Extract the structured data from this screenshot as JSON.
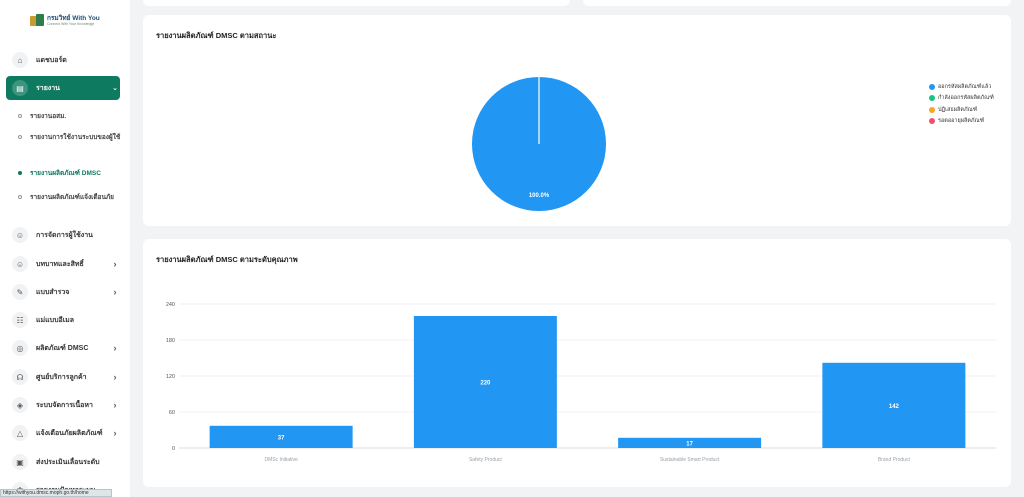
{
  "logo": {
    "title": "กรมวิทย์ With You",
    "subtitle": "Connect With Your Knowledge"
  },
  "sidebar": {
    "items": [
      {
        "label": "แดชบอร์ด",
        "icon": "home-icon",
        "glyph": "⌂",
        "chevron": ""
      },
      {
        "label": "รายงาน",
        "icon": "report-icon",
        "glyph": "▤",
        "chevron": "⌄"
      },
      {
        "label": "การจัดการผู้ใช้งาน",
        "icon": "users-icon",
        "glyph": "☺",
        "chevron": ""
      },
      {
        "label": "บทบาทและสิทธิ์",
        "icon": "roles-icon",
        "glyph": "☺",
        "chevron": "›"
      },
      {
        "label": "แบบสำรวจ",
        "icon": "paperclip-icon",
        "glyph": "✎",
        "chevron": "›"
      },
      {
        "label": "แม่แบบอีเมล",
        "icon": "template-icon",
        "glyph": "☷",
        "chevron": ""
      },
      {
        "label": "ผลิตภัณฑ์ DMSC",
        "icon": "product-icon",
        "glyph": "◎",
        "chevron": "›"
      },
      {
        "label": "ศูนย์บริการลูกค้า",
        "icon": "headset-icon",
        "glyph": "☊",
        "chevron": "›"
      },
      {
        "label": "ระบบจัดการเนื้อหา",
        "icon": "cube-icon",
        "glyph": "◈",
        "chevron": "›"
      },
      {
        "label": "แจ้งเตือนภัยผลิตภัณฑ์",
        "icon": "warning-icon",
        "glyph": "△",
        "chevron": "›"
      },
      {
        "label": "ส่งประเมินเลื่อนระดับ",
        "icon": "archive-icon",
        "glyph": "▣",
        "chevron": ""
      },
      {
        "label": "รายงานปัญหาระบบ",
        "icon": "bug-icon",
        "glyph": "✱",
        "chevron": ""
      }
    ],
    "sub_items": [
      {
        "label": "รายงานอสม."
      },
      {
        "label": "รายงานการใช้งานระบบของผู้ใช้"
      },
      {
        "label": "รายงานผลิตภัณฑ์ DMSC"
      },
      {
        "label": "รายงานผลิตภัณฑ์แจ้งเตือนภัย"
      }
    ]
  },
  "status_url": "https://withyou.dmsc.moph.go.th/home",
  "pie_card": {
    "title": "รายงานผลิตภัณฑ์ DMSC ตามสถานะ"
  },
  "bar_card": {
    "title": "รายงานผลิตภัณฑ์ DMSC ตามระดับคุณภาพ"
  },
  "colors": {
    "primary": "#0e7a5f",
    "bar": "#2196f3",
    "pie": "#2196f3"
  },
  "chart_data": [
    {
      "type": "pie",
      "title": "รายงานผลิตภัณฑ์ DMSC ตามสถานะ",
      "legend_position": "right",
      "series": [
        {
          "name": "ออกรหัสผลิตภัณฑ์แล้ว",
          "value": 100.0,
          "label": "100.0%",
          "color": "#2196f3"
        },
        {
          "name": "กำลังออกรหัสผลิตภัณฑ์",
          "value": 0,
          "color": "#19c37d"
        },
        {
          "name": "ปฏิเสธผลิตภัณฑ์",
          "value": 0,
          "color": "#f5a623"
        },
        {
          "name": "รอตออายุผลิตภัณฑ์",
          "value": 0,
          "color": "#f0506e"
        }
      ]
    },
    {
      "type": "bar",
      "title": "รายงานผลิตภัณฑ์ DMSC ตามระดับคุณภาพ",
      "categories": [
        "DMSc Initiative",
        "Safety Product",
        "Sustainable Smart Product",
        "Brand Product"
      ],
      "values": [
        37,
        220,
        17,
        142
      ],
      "ylim": [
        0,
        240
      ],
      "yticks": [
        0,
        60,
        120,
        180,
        240
      ],
      "grid": true,
      "color": "#2196f3"
    }
  ]
}
